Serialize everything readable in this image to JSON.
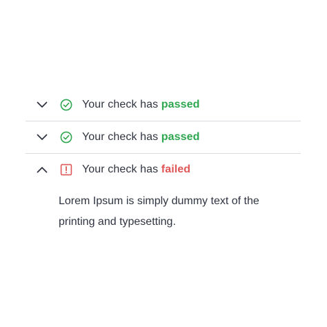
{
  "colors": {
    "passed": "#2ea64f",
    "failed": "#e05656",
    "divider": "#d9dbe0",
    "text": "#2f3440"
  },
  "items": [
    {
      "expanded": false,
      "chevron_icon": "chevron-down-icon",
      "status_icon": "check-circle-icon",
      "prefix": "Your check has",
      "status": "passed"
    },
    {
      "expanded": false,
      "chevron_icon": "chevron-down-icon",
      "status_icon": "check-circle-icon",
      "prefix": "Your check has",
      "status": "passed"
    },
    {
      "expanded": true,
      "chevron_icon": "chevron-up-icon",
      "status_icon": "alert-square-icon",
      "prefix": "Your check has",
      "status": "failed",
      "body": "Lorem Ipsum is simply dummy text of the printing and typesetting."
    }
  ]
}
